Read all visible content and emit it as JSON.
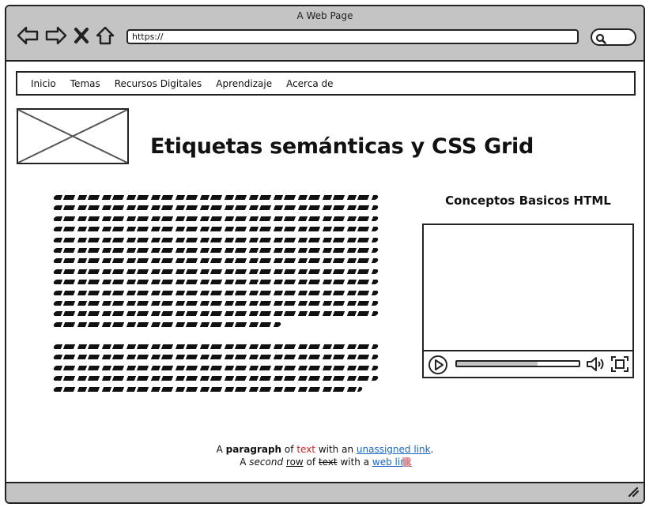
{
  "window": {
    "title": "A Web Page"
  },
  "browser": {
    "url": "https://",
    "icons": [
      "back-arrow-icon",
      "forward-arrow-icon",
      "close-icon",
      "home-icon",
      "search-icon"
    ]
  },
  "nav": {
    "items": [
      "Inicio",
      "Temas",
      "Recursos Digitales",
      "Aprendizaje",
      "Acerca de"
    ]
  },
  "header": {
    "title": "Etiquetas semánticas y CSS Grid"
  },
  "aside": {
    "title": "Conceptos Basicos HTML"
  },
  "video": {
    "progress": 0.66
  },
  "footer": {
    "line1": {
      "a": "A ",
      "bold": "paragraph",
      "b": " of ",
      "red": "text",
      "c": " with an ",
      "link": "unassigned link",
      "d": "."
    },
    "line2": {
      "a": "A ",
      "italic": "second",
      "b": " ",
      "underlined": "row",
      "c": " of ",
      "strike": "text",
      "d": " with a ",
      "link": "web link"
    }
  },
  "colors": {
    "chrome": "#c4c4c4",
    "border": "#222222",
    "link": "#1a66c4",
    "red_text": "#d21f1f"
  }
}
